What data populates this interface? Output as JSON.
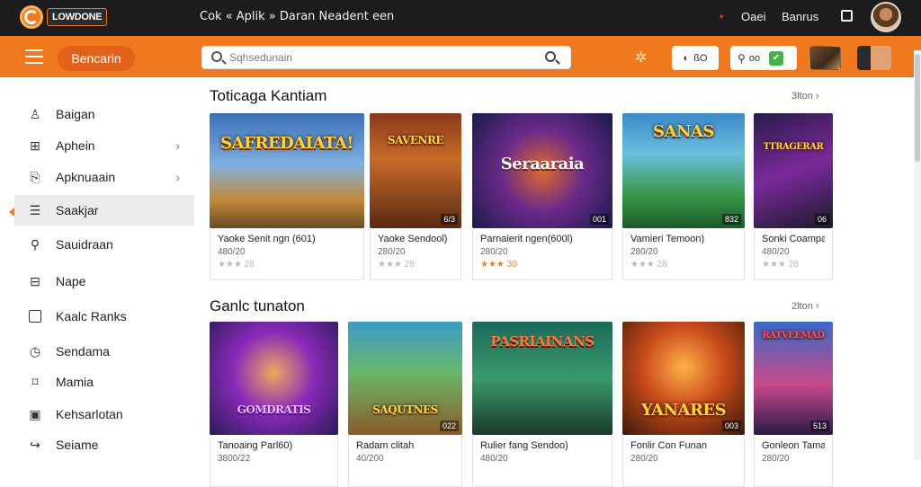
{
  "topbar": {
    "logo_text": "LOWDONE",
    "title": "Cok « Aplik » Daran Neadent een",
    "link1": "Oaei",
    "link2": "Banrus"
  },
  "header": {
    "brand_button": "Bencarin",
    "search_placeholder": "Sqhsedunain",
    "chip1_text": "ßO",
    "chip2_text": "oo"
  },
  "sidebar": {
    "items": [
      {
        "label": "Baigan",
        "icon": "user-icon"
      },
      {
        "label": "Aphein",
        "icon": "grid-icon",
        "chevron": true
      },
      {
        "label": "Apknuaain",
        "icon": "document-icon",
        "chevron": true
      },
      {
        "label": "Saakjar",
        "icon": "list-icon",
        "active": true
      },
      {
        "label": "Sauidraan",
        "icon": "search-icon"
      },
      {
        "label": "Nape",
        "icon": "table-icon"
      },
      {
        "label": "Kaalc Ranks",
        "icon": "folder-icon"
      },
      {
        "label": "Sendama",
        "icon": "clock-icon"
      },
      {
        "label": "Mamia",
        "icon": "bookmark-icon"
      },
      {
        "label": "Kehsarlotan",
        "icon": "calendar-icon"
      },
      {
        "label": "Seiame",
        "icon": "share-icon"
      }
    ]
  },
  "section1": {
    "title": "Toticaga Kantiam",
    "more": "3lton",
    "cards": [
      {
        "thumb_text": "SAFREDAIATA!",
        "badge": "",
        "name": "Yaoke Senit ngn (601)",
        "sub": "480/20",
        "rating": "★★★ 28",
        "gold": false
      },
      {
        "thumb_text": "SAVENRE",
        "badge": "6/3",
        "name": "Yaoke Sendool)",
        "sub": "280/20",
        "rating": "★★★ 28",
        "gold": false
      },
      {
        "thumb_text": "Seraaraia",
        "badge": "001",
        "name": "Parnaierit ngen(600l)",
        "sub": "280/20",
        "rating": "★★★ 30",
        "gold": true
      },
      {
        "thumb_text": "SANAS",
        "badge": "832",
        "name": "Vamieri Temoon)",
        "sub": "280/20",
        "rating": "★★★ 28",
        "gold": false
      },
      {
        "thumb_text": "TTRAGERAR",
        "badge": "06",
        "name": "Sonki Coampal",
        "sub": "480/20",
        "rating": "★★★ 28",
        "gold": false
      }
    ]
  },
  "section2": {
    "title": "Ganlc tunaton",
    "more": "2lton",
    "cards": [
      {
        "thumb_text": "GOMDRATIS",
        "badge": "",
        "name": "Tanoaing Parl60)",
        "sub": "3800/22",
        "rating": "",
        "gold": false
      },
      {
        "thumb_text": "SAQUTNES",
        "badge": "022",
        "name": "Radam clitah",
        "sub": "40/200",
        "rating": "",
        "gold": false
      },
      {
        "thumb_text": "PASRIAINANS",
        "badge": "",
        "name": "Rulier fang Sendoo)",
        "sub": "480/20",
        "rating": "",
        "gold": false
      },
      {
        "thumb_text": "YANARES",
        "badge": "003",
        "name": "Fonlir Con Funan",
        "sub": "280/20",
        "rating": "",
        "gold": false
      },
      {
        "thumb_text": "RATVEEMAD",
        "badge": "513",
        "name": "Gonleon Tama",
        "sub": "280/20",
        "rating": "",
        "gold": false
      }
    ]
  }
}
